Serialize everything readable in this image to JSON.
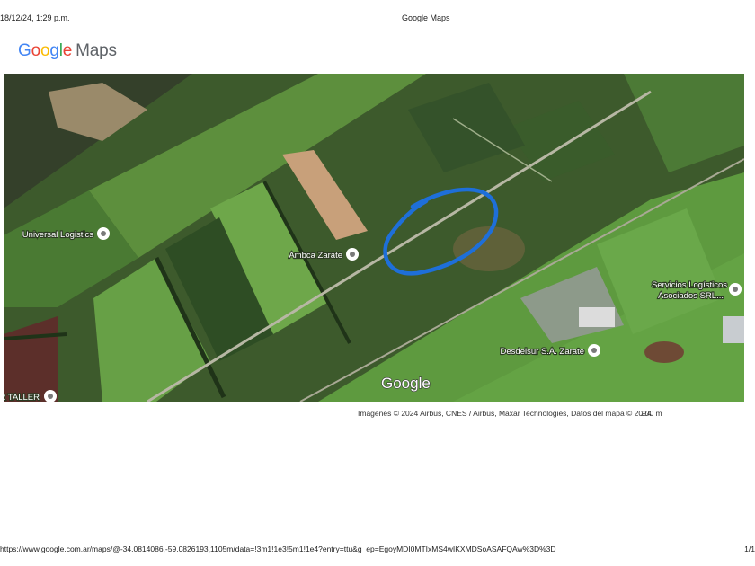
{
  "print_header": {
    "datetime": "18/12/24, 1:29 p.m.",
    "page_title": "Google Maps"
  },
  "logo": {
    "google": [
      "G",
      "o",
      "o",
      "g",
      "l",
      "e"
    ],
    "maps": "Maps"
  },
  "map": {
    "view": "satellite",
    "watermark": "Google",
    "places": [
      {
        "name": "Universal Logistics"
      },
      {
        "name": "Ambca Zarate"
      },
      {
        "name": "Servicios Logísticos",
        "name_line2": "Asociados SRL..."
      },
      {
        "name": "Desdelsur S.A. Zarate"
      },
      {
        "name": "AR TALLER"
      }
    ],
    "annotation": {
      "shape": "hand-drawn loop",
      "color": "#1E6FD9"
    }
  },
  "attribution": "Imágenes © 2024 Airbus, CNES / Airbus, Maxar Technologies, Datos del mapa © 2024",
  "scale_label": "200 m",
  "print_footer": {
    "url": "https://www.google.com.ar/maps/@-34.0814086,-59.0826193,1105m/data=!3m1!1e3!5m1!1e4?entry=ttu&g_ep=EgoyMDI0MTIxMS4wIKXMDSoASAFQAw%3D%3D",
    "page": "1/1"
  },
  "colors": {
    "field_green": "#5a8a3a",
    "dark_green": "#2f4a25",
    "bright_green": "#6fa84a",
    "road": "#b9b9a8",
    "pin": "#ffffff",
    "annotation": "#1E6FD9"
  }
}
